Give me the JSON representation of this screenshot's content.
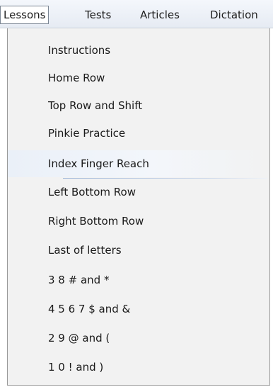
{
  "menubar": {
    "items": [
      {
        "label": "Lessons",
        "active": true
      },
      {
        "label": "Tests",
        "active": false
      },
      {
        "label": "Articles",
        "active": false
      },
      {
        "label": "Dictation",
        "active": false
      }
    ]
  },
  "lessons_menu": {
    "items": [
      {
        "label": "Instructions"
      },
      {
        "label": "Home Row"
      },
      {
        "label": "Top Row and Shift"
      },
      {
        "label": "Pinkie Practice"
      },
      {
        "label": "Index Finger Reach",
        "hovered": true
      },
      {
        "label": "Left Bottom Row"
      },
      {
        "label": "Right Bottom Row"
      },
      {
        "label": "Last of letters"
      },
      {
        "label": "3 8 # and *"
      },
      {
        "label": "4 5 6 7 $ and &"
      },
      {
        "label": "2 9 @ and ("
      },
      {
        "label": "1 0 ! and )"
      }
    ]
  },
  "colors": {
    "menubar_bg": "#e9eef5",
    "dropdown_bg": "#f2f2f2",
    "hover_accent": "#9eb6d8"
  }
}
